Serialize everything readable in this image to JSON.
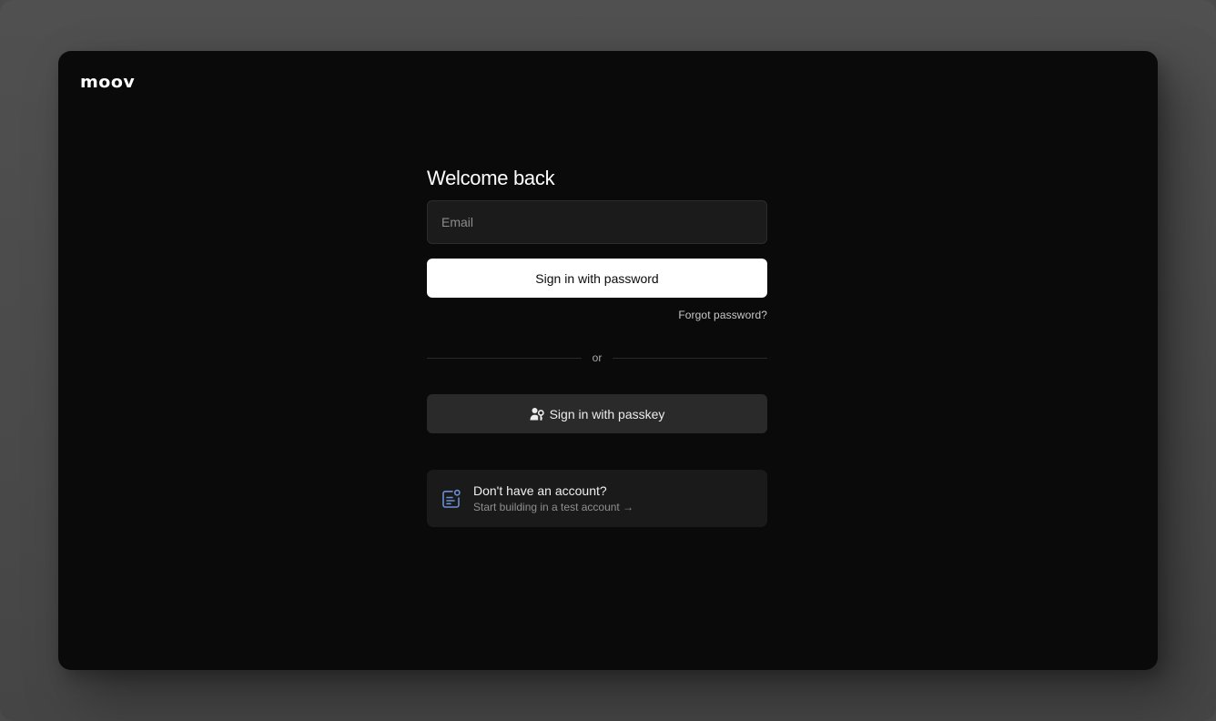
{
  "brand": {
    "logo_text": "moov"
  },
  "login": {
    "title": "Welcome back",
    "email_placeholder": "Email",
    "email_value": "",
    "password_button_label": "Sign in with password",
    "forgot_password_label": "Forgot password?",
    "divider_label": "or",
    "passkey_button_label": "Sign in with passkey",
    "passkey_icon": "user-key-icon"
  },
  "signup": {
    "title": "Don't have an account?",
    "subtitle": "Start building in a test account →",
    "icon": "form-notification-icon",
    "icon_color": "#6b8fd6"
  },
  "colors": {
    "backdrop": "#4a4a4a",
    "window_bg": "#0a0a0a",
    "primary_button_bg": "#ffffff",
    "secondary_button_bg": "#2a2a2a",
    "card_bg": "#1a1a1a"
  }
}
